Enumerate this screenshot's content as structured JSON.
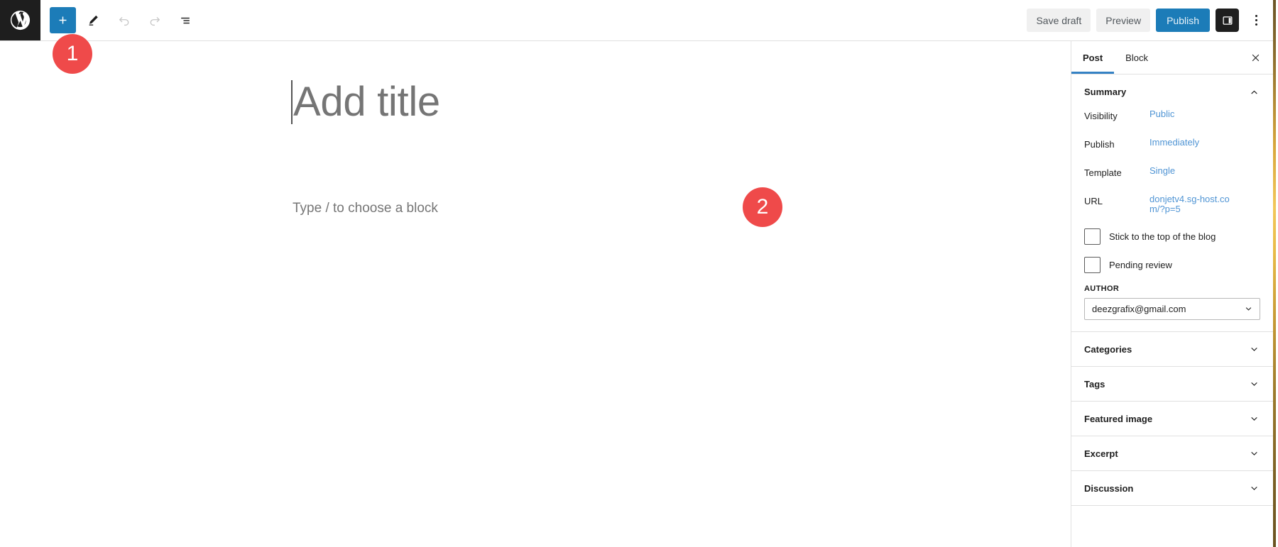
{
  "header": {
    "logo_icon": "wordpress-logo-icon",
    "tools": [
      {
        "name": "block-inserter-toggle",
        "icon": "plus-icon",
        "state": "active"
      },
      {
        "name": "tools-edit-mode",
        "icon": "pencil-icon",
        "state": "default"
      },
      {
        "name": "undo",
        "icon": "undo-icon",
        "state": "disabled"
      },
      {
        "name": "redo",
        "icon": "redo-icon",
        "state": "disabled"
      },
      {
        "name": "document-overview",
        "icon": "list-view-icon",
        "state": "default"
      }
    ],
    "save_draft_label": "Save draft",
    "preview_label": "Preview",
    "publish_label": "Publish",
    "settings_toggle_icon": "sidebar-panel-icon",
    "options_icon": "kebab-menu-icon",
    "accent_blue": "#1c7cb8"
  },
  "editor": {
    "title_placeholder": "Add title",
    "block_placeholder": "Type / to choose a block",
    "inserter_icon": "plus-icon"
  },
  "annotations": [
    {
      "number": "1",
      "color": "#ef4a4a"
    },
    {
      "number": "2",
      "color": "#ef4a4a"
    }
  ],
  "sidebar": {
    "tabs": [
      {
        "label": "Post",
        "active": true
      },
      {
        "label": "Block",
        "active": false
      }
    ],
    "close_icon": "close-icon",
    "summary": {
      "title": "Summary",
      "collapse_icon": "chevron-up-icon",
      "rows": [
        {
          "label": "Visibility",
          "value": "Public"
        },
        {
          "label": "Publish",
          "value": "Immediately"
        },
        {
          "label": "Template",
          "value": "Single"
        },
        {
          "label": "URL",
          "value": "donjetv4.sg-host.com/?p=5"
        }
      ],
      "checkboxes": [
        {
          "label": "Stick to the top of the blog",
          "checked": false
        },
        {
          "label": "Pending review",
          "checked": false
        }
      ],
      "author_label": "AUTHOR",
      "author_value": "deezgrafix@gmail.com",
      "author_dropdown_icon": "chevron-down-icon"
    },
    "panels": [
      {
        "label": "Categories",
        "icon": "chevron-down-icon"
      },
      {
        "label": "Tags",
        "icon": "chevron-down-icon"
      },
      {
        "label": "Featured image",
        "icon": "chevron-down-icon"
      },
      {
        "label": "Excerpt",
        "icon": "chevron-down-icon"
      },
      {
        "label": "Discussion",
        "icon": "chevron-down-icon"
      }
    ]
  }
}
